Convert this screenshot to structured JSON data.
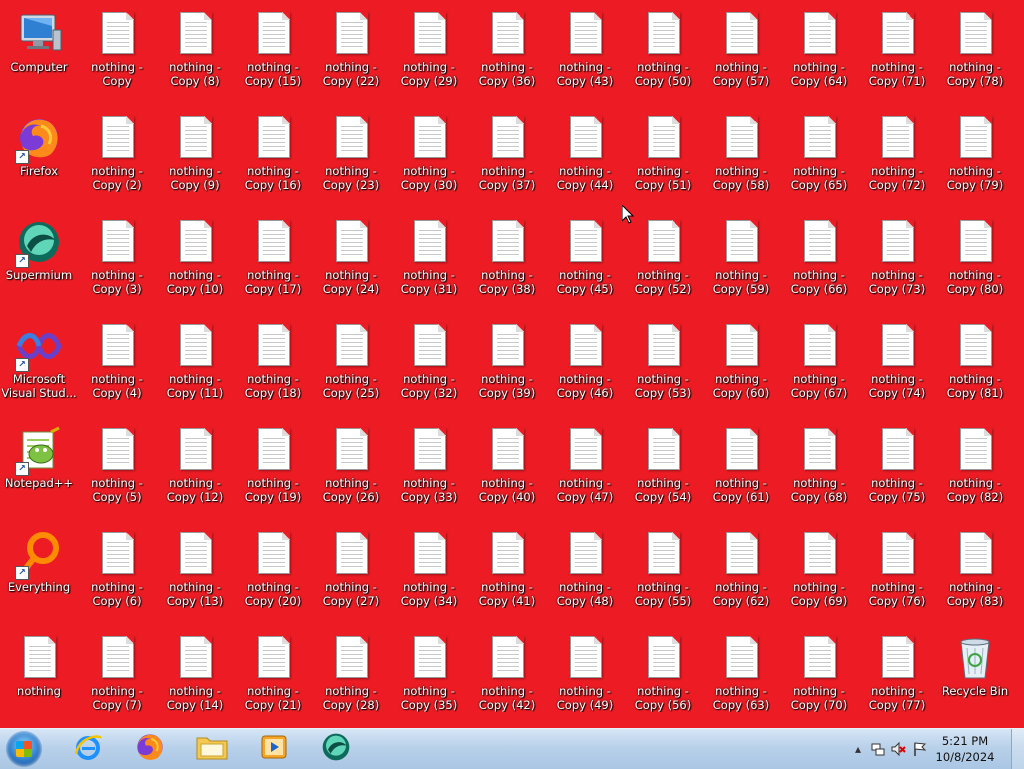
{
  "system_icons": [
    {
      "id": "computer",
      "label": "Computer",
      "icon": "computer-icon"
    },
    {
      "id": "firefox",
      "label": "Firefox",
      "icon": "firefox-icon",
      "shortcut": true
    },
    {
      "id": "supermium",
      "label": "Supermium",
      "icon": "supermium-icon",
      "shortcut": true
    },
    {
      "id": "visual-studio",
      "label": "Microsoft\nVisual Stud...",
      "icon": "visual-studio-icon",
      "shortcut": true
    },
    {
      "id": "notepadpp",
      "label": "Notepad++",
      "icon": "notepadpp-icon",
      "shortcut": true
    },
    {
      "id": "everything",
      "label": "Everything",
      "icon": "everything-icon",
      "shortcut": true
    },
    {
      "id": "nothing",
      "label": "nothing",
      "icon": "text-file-icon"
    }
  ],
  "file_columns": [
    [
      "nothing -\nCopy",
      "nothing -\nCopy (2)",
      "nothing -\nCopy (3)",
      "nothing -\nCopy (4)",
      "nothing -\nCopy (5)",
      "nothing -\nCopy (6)",
      "nothing -\nCopy (7)"
    ],
    [
      "nothing -\nCopy (8)",
      "nothing -\nCopy (9)",
      "nothing -\nCopy (10)",
      "nothing -\nCopy (11)",
      "nothing -\nCopy (12)",
      "nothing -\nCopy (13)",
      "nothing -\nCopy (14)"
    ],
    [
      "nothing -\nCopy (15)",
      "nothing -\nCopy (16)",
      "nothing -\nCopy (17)",
      "nothing -\nCopy (18)",
      "nothing -\nCopy (19)",
      "nothing -\nCopy (20)",
      "nothing -\nCopy (21)"
    ],
    [
      "nothing -\nCopy (22)",
      "nothing -\nCopy (23)",
      "nothing -\nCopy (24)",
      "nothing -\nCopy (25)",
      "nothing -\nCopy (26)",
      "nothing -\nCopy (27)",
      "nothing -\nCopy (28)"
    ],
    [
      "nothing -\nCopy (29)",
      "nothing -\nCopy (30)",
      "nothing -\nCopy (31)",
      "nothing -\nCopy (32)",
      "nothing -\nCopy (33)",
      "nothing -\nCopy (34)",
      "nothing -\nCopy (35)"
    ],
    [
      "nothing -\nCopy (36)",
      "nothing -\nCopy (37)",
      "nothing -\nCopy (38)",
      "nothing -\nCopy (39)",
      "nothing -\nCopy (40)",
      "nothing -\nCopy (41)",
      "nothing -\nCopy (42)"
    ],
    [
      "nothing -\nCopy (43)",
      "nothing -\nCopy (44)",
      "nothing -\nCopy (45)",
      "nothing -\nCopy (46)",
      "nothing -\nCopy (47)",
      "nothing -\nCopy (48)",
      "nothing -\nCopy (49)"
    ],
    [
      "nothing -\nCopy (50)",
      "nothing -\nCopy (51)",
      "nothing -\nCopy (52)",
      "nothing -\nCopy (53)",
      "nothing -\nCopy (54)",
      "nothing -\nCopy (55)",
      "nothing -\nCopy (56)"
    ],
    [
      "nothing -\nCopy (57)",
      "nothing -\nCopy (58)",
      "nothing -\nCopy (59)",
      "nothing -\nCopy (60)",
      "nothing -\nCopy (61)",
      "nothing -\nCopy (62)",
      "nothing -\nCopy (63)"
    ],
    [
      "nothing -\nCopy (64)",
      "nothing -\nCopy (65)",
      "nothing -\nCopy (66)",
      "nothing -\nCopy (67)",
      "nothing -\nCopy (68)",
      "nothing -\nCopy (69)",
      "nothing -\nCopy (70)"
    ],
    [
      "nothing -\nCopy (71)",
      "nothing -\nCopy (72)",
      "nothing -\nCopy (73)",
      "nothing -\nCopy (74)",
      "nothing -\nCopy (75)",
      "nothing -\nCopy (76)",
      "nothing -\nCopy (77)"
    ],
    [
      "nothing -\nCopy (78)",
      "nothing -\nCopy (79)",
      "nothing -\nCopy (80)",
      "nothing -\nCopy (81)",
      "nothing -\nCopy (82)",
      "nothing -\nCopy (83)",
      "Recycle Bin"
    ]
  ],
  "taskbar": {
    "pinned": [
      {
        "id": "ie",
        "icon": "internet-explorer-icon"
      },
      {
        "id": "firefox",
        "icon": "firefox-icon"
      },
      {
        "id": "explorer",
        "icon": "folder-icon"
      },
      {
        "id": "media",
        "icon": "media-player-icon"
      },
      {
        "id": "supermium",
        "icon": "supermium-icon"
      }
    ],
    "clock": {
      "time": "5:21 PM",
      "date": "10/8/2024"
    }
  },
  "colors": {
    "desktop_background": "#ed1c24",
    "taskbar": "#b9d1ea"
  }
}
